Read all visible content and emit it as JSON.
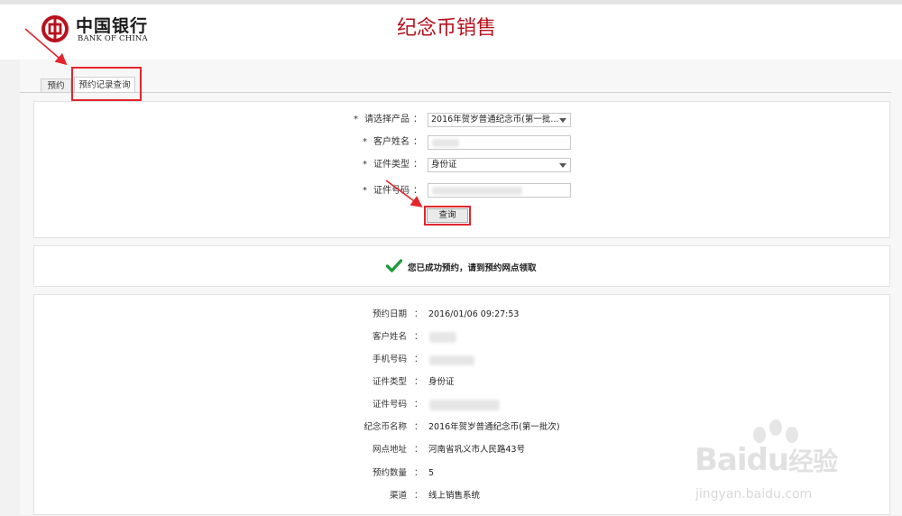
{
  "header": {
    "logo_cn": "中国银行",
    "logo_en": "BANK OF CHINA",
    "title": "纪念币销售"
  },
  "tabs": [
    {
      "label": "预约"
    },
    {
      "label": "预约记录查询"
    }
  ],
  "form": {
    "product": {
      "label": "请选择产品",
      "value": "2016年贺岁普通纪念币(第一批..."
    },
    "name": {
      "label": "客户姓名"
    },
    "id_type": {
      "label": "证件类型",
      "value": "身份证"
    },
    "id_number": {
      "label": "证件号码"
    },
    "required_mark": "*",
    "colon": "：",
    "query_button": "查询"
  },
  "message": {
    "text": "您已成功预约，请到预约网点领取"
  },
  "details": [
    {
      "label": "预约日期",
      "value": "2016/01/06 09:27:53"
    },
    {
      "label": "客户姓名",
      "value": ""
    },
    {
      "label": "手机号码",
      "value": ""
    },
    {
      "label": "证件类型",
      "value": "身份证"
    },
    {
      "label": "证件号码",
      "value": ""
    },
    {
      "label": "纪念币名称",
      "value": "2016年贺岁普通纪念币(第一批次)"
    },
    {
      "label": "网点地址",
      "value": "河南省巩义市人民路43号"
    },
    {
      "label": "预约数量",
      "value": "5"
    },
    {
      "label": "渠道",
      "value": "线上销售系统"
    }
  ],
  "watermark": {
    "brand": "Bai",
    "brand2": "du",
    "suffix": "经验",
    "url": "jingyan.baidu.com"
  },
  "colors": {
    "brand_red": "#b8121e",
    "highlight_red": "#e3252c",
    "success_green": "#1f9c3a"
  }
}
